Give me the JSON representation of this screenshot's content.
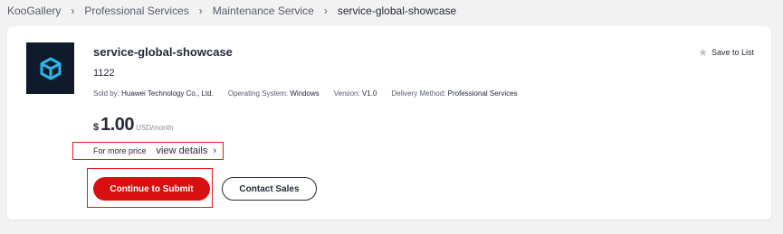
{
  "breadcrumb": {
    "items": [
      {
        "label": "KooGallery"
      },
      {
        "label": "Professional Services"
      },
      {
        "label": "Maintenance Service"
      },
      {
        "label": "service-global-showcase"
      }
    ],
    "separator": "›"
  },
  "product": {
    "title": "service-global-showcase",
    "subtitle": "1122",
    "meta": [
      {
        "key": "Sold by: ",
        "value": "Huawei Technology Co., Ltd."
      },
      {
        "key": "Operating System: ",
        "value": "Windows"
      },
      {
        "key": "Version: ",
        "value": "V1.0"
      },
      {
        "key": "Delivery Method: ",
        "value": "Professional Services"
      }
    ],
    "save_label": "Save to List",
    "logo_icon": "cube-icon"
  },
  "price": {
    "currency": "$",
    "amount": "1.00",
    "unit": "USD/month",
    "more_label": "For more price",
    "details_link": "view details",
    "chevron": "›"
  },
  "actions": {
    "submit_label": "Continue to Submit",
    "contact_label": "Contact Sales"
  },
  "colors": {
    "accent": "#d70f0f",
    "highlight_box": "#e41b1b",
    "logo_bg": "#0f1a2b",
    "logo_icon": "#29b6e8"
  }
}
